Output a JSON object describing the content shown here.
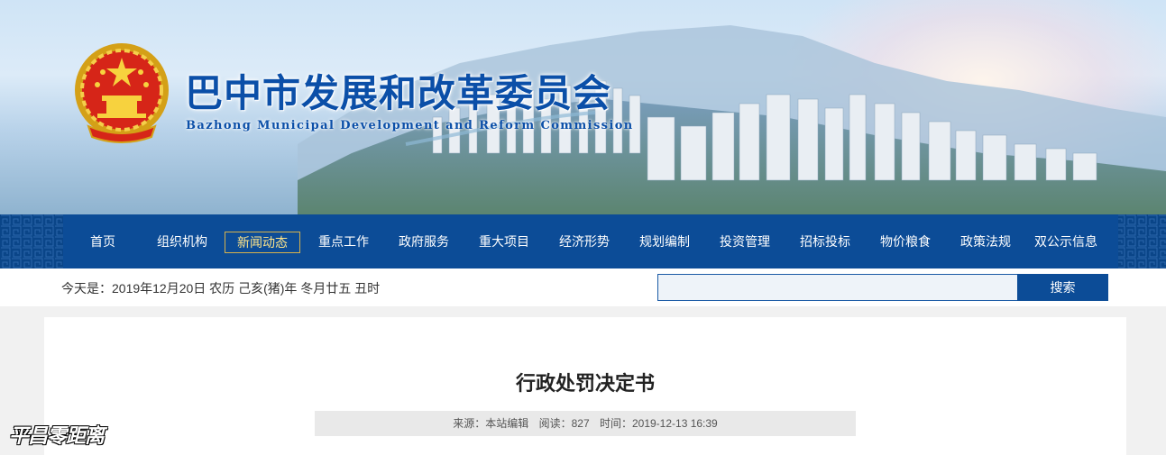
{
  "header": {
    "title": "巴中市发展和改革委员会",
    "subtitle": "Bazhong Municipal Development and Reform Commission",
    "emblem_icon": "national-emblem-icon"
  },
  "nav": {
    "items": [
      {
        "label": "首页",
        "active": false
      },
      {
        "label": "组织机构",
        "active": false
      },
      {
        "label": "新闻动态",
        "active": true
      },
      {
        "label": "重点工作",
        "active": false
      },
      {
        "label": "政府服务",
        "active": false
      },
      {
        "label": "重大项目",
        "active": false
      },
      {
        "label": "经济形势",
        "active": false
      },
      {
        "label": "规划编制",
        "active": false
      },
      {
        "label": "投资管理",
        "active": false
      },
      {
        "label": "招标投标",
        "active": false
      },
      {
        "label": "物价粮食",
        "active": false
      },
      {
        "label": "政策法规",
        "active": false
      },
      {
        "label": "双公示信息",
        "active": false
      }
    ]
  },
  "infobar": {
    "date_text": "今天是：2019年12月20日 农历 己亥(猪)年 冬月廿五 丑时",
    "search": {
      "value": "",
      "placeholder": "",
      "button_label": "搜索"
    }
  },
  "article": {
    "title": "行政处罚决定书",
    "source": "来源：本站编辑",
    "reads": "阅读：827",
    "time": "时间：2019-12-13 16:39"
  },
  "watermark": "平昌零距离",
  "colors": {
    "nav_bg": "#0c4c97",
    "title_blue": "#0b4fa8",
    "active_border": "#d7b24c",
    "page_bg": "#f1f1f1"
  }
}
